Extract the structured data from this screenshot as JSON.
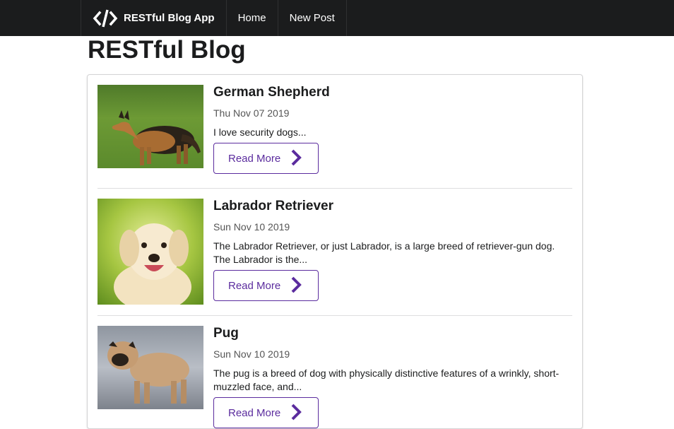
{
  "nav": {
    "brand": "RESTful Blog App",
    "brand_icon": "code-icon",
    "items": [
      {
        "label": "Home"
      },
      {
        "label": "New Post"
      }
    ]
  },
  "page": {
    "title": "RESTful Blog"
  },
  "posts": [
    {
      "title": "German Shepherd",
      "date": "Thu Nov 07 2019",
      "excerpt": "I love security dogs...",
      "read_more": "Read More",
      "image": "german-shepherd-photo"
    },
    {
      "title": "Labrador Retriever",
      "date": "Sun Nov 10 2019",
      "excerpt": "The Labrador Retriever, or just Labrador, is a large breed of retriever-gun dog. The Labrador is the...",
      "read_more": "Read More",
      "image": "labrador-puppy-photo"
    },
    {
      "title": "Pug",
      "date": "Sun Nov 10 2019",
      "excerpt": "The pug is a breed of dog with physically distinctive features of a wrinkly, short-muzzled face, and...",
      "read_more": "Read More",
      "image": "pug-photo"
    }
  ],
  "colors": {
    "navbar": "#1b1c1d",
    "accent": "#5b2c9e"
  }
}
